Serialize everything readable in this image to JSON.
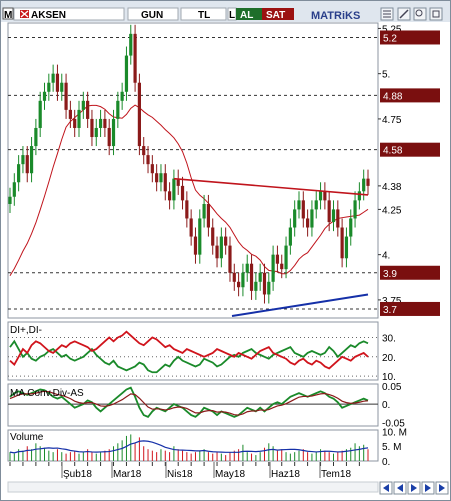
{
  "toolbar": {
    "app_icon_letter": "M",
    "symbol": "AKSEN",
    "period": "GUN",
    "currency": "TL",
    "small_label": "L",
    "buy_label": "AL",
    "sell_label": "SAT",
    "brand": "MATRiKS",
    "icons": [
      "grid-icon",
      "settings-icon",
      "zoom-icon",
      "restore-icon"
    ]
  },
  "colors": {
    "candle_up": "#1a8a2a",
    "candle_down": "#8b1a1a",
    "price_label_bg": "#7a0f0f",
    "moving_average": "#c0141c",
    "support_line": "#1530a8",
    "di_plus": "#1a8a2a",
    "di_minus": "#d0141c",
    "macd": "#1a8a2a",
    "signal": "#8b1a1a",
    "volume_down": "#d0141c",
    "volume_up": "#1a8a2a",
    "volume_ma": "#1530a8",
    "buy_bg": "#1e6e2a",
    "sell_bg": "#9b1111"
  },
  "price_panel": {
    "axis_labels": [
      "5.25",
      "5.",
      "4.75",
      "4.38",
      "4.25",
      "4.",
      "3.75"
    ],
    "level_labels": [
      "5.2",
      "4.88",
      "4.58",
      "3.9",
      "3.7"
    ],
    "ylim": [
      3.65,
      5.28
    ]
  },
  "dmi_panel": {
    "title": "DI+,DI-",
    "axis_labels": [
      "30.",
      "20.",
      "10."
    ]
  },
  "macd_panel": {
    "title": "MA Conv.Div-AS",
    "axis_labels": [
      "0.05",
      "0.",
      "-0.05"
    ]
  },
  "volume_panel": {
    "title": "Volume",
    "axis_labels": [
      "10. M",
      "5. M",
      "0."
    ]
  },
  "x_axis": {
    "labels": [
      "Şub18",
      "Mar18",
      "Nis18",
      "May18",
      "Haz18",
      "Tem18"
    ]
  },
  "chart_data": [
    {
      "type": "candlestick",
      "name": "price",
      "ylim": [
        3.65,
        5.28
      ],
      "horizontal_levels": [
        5.2,
        4.88,
        4.58,
        3.9,
        3.7
      ],
      "approx_close": [
        4.32,
        4.4,
        4.5,
        4.55,
        4.45,
        4.6,
        4.7,
        4.85,
        4.9,
        4.95,
        5.0,
        4.9,
        4.95,
        4.8,
        4.75,
        4.7,
        4.8,
        4.85,
        4.75,
        4.65,
        4.7,
        4.75,
        4.7,
        4.6,
        4.75,
        4.85,
        4.9,
        5.1,
        5.22,
        4.95,
        4.6,
        4.55,
        4.5,
        4.45,
        4.4,
        4.45,
        4.35,
        4.3,
        4.42,
        4.38,
        4.3,
        4.2,
        4.1,
        4.0,
        4.2,
        4.28,
        4.15,
        4.05,
        3.98,
        4.1,
        4.05,
        3.9,
        3.85,
        3.82,
        3.9,
        3.95,
        3.8,
        3.85,
        3.9,
        3.78,
        3.85,
        4.0,
        3.95,
        3.92,
        4.05,
        4.15,
        4.25,
        4.3,
        4.2,
        4.15,
        4.25,
        4.3,
        4.35,
        4.3,
        4.18,
        4.25,
        4.15,
        3.98,
        4.1,
        4.2,
        4.3,
        4.35,
        4.42,
        4.38
      ]
    },
    {
      "type": "line",
      "name": "DI+,DI-",
      "ylim": [
        8,
        38
      ],
      "series": [
        {
          "name": "DI+",
          "values": [
            25,
            28,
            24,
            20,
            22,
            19,
            18,
            20,
            21,
            23,
            24,
            22,
            20,
            21,
            19,
            18,
            19,
            20,
            22,
            24,
            21,
            19,
            17,
            16,
            18,
            15,
            14,
            13,
            14,
            15,
            17,
            16,
            13,
            12,
            12,
            14,
            16,
            15,
            18,
            20,
            18,
            17,
            16,
            15,
            16,
            19,
            18,
            17,
            15,
            16,
            18,
            20,
            21,
            20,
            22,
            23,
            24,
            22,
            21,
            20,
            19,
            21,
            22,
            23,
            24,
            25,
            22,
            21,
            20,
            22,
            23,
            22,
            21,
            22,
            25,
            23,
            20,
            22,
            24,
            26,
            25,
            27,
            28,
            27
          ]
        },
        {
          "name": "DI-",
          "values": [
            18,
            16,
            20,
            24,
            22,
            26,
            28,
            27,
            25,
            23,
            22,
            24,
            26,
            25,
            27,
            28,
            27,
            26,
            25,
            23,
            24,
            26,
            28,
            30,
            28,
            30,
            31,
            33,
            31,
            29,
            27,
            26,
            28,
            30,
            29,
            27,
            25,
            26,
            24,
            23,
            22,
            24,
            23,
            22,
            21,
            20,
            21,
            22,
            24,
            23,
            22,
            21,
            20,
            22,
            21,
            20,
            19,
            21,
            23,
            24,
            25,
            22,
            21,
            20,
            19,
            17,
            16,
            18,
            19,
            17,
            16,
            18,
            17,
            15,
            14,
            16,
            18,
            20,
            19,
            18,
            20,
            21,
            22,
            20
          ]
        }
      ]
    },
    {
      "type": "line",
      "name": "MA Conv.Div-AS",
      "ylim": [
        -0.06,
        0.055
      ],
      "series": [
        {
          "name": "macd",
          "values": [
            0.02,
            0.03,
            0.035,
            0.03,
            0.025,
            0.03,
            0.035,
            0.04,
            0.038,
            0.03,
            0.02,
            0.015,
            0.02,
            0.01,
            0.0,
            -0.01,
            -0.005,
            0.0,
            0.01,
            0.005,
            -0.01,
            -0.02,
            -0.01,
            0.0,
            0.01,
            0.02,
            0.03,
            0.04,
            0.045,
            0.02,
            -0.01,
            -0.03,
            -0.035,
            -0.02,
            -0.01,
            -0.015,
            -0.02,
            -0.01,
            0.0,
            -0.005,
            -0.01,
            -0.02,
            -0.03,
            -0.035,
            -0.025,
            -0.01,
            -0.015,
            -0.02,
            -0.03,
            -0.02,
            -0.025,
            -0.03,
            -0.035,
            -0.03,
            -0.02,
            -0.01,
            -0.015,
            -0.02,
            -0.01,
            -0.02,
            -0.01,
            0.0,
            0.005,
            0.0,
            0.01,
            0.02,
            0.025,
            0.03,
            0.025,
            0.02,
            0.025,
            0.03,
            0.035,
            0.03,
            0.02,
            0.015,
            0.005,
            -0.01,
            -0.005,
            0.0,
            0.005,
            0.01,
            0.015,
            0.01
          ]
        },
        {
          "name": "signal",
          "values": [
            0.015,
            0.02,
            0.025,
            0.028,
            0.028,
            0.028,
            0.03,
            0.033,
            0.035,
            0.034,
            0.03,
            0.026,
            0.024,
            0.02,
            0.015,
            0.008,
            0.004,
            0.002,
            0.004,
            0.004,
            0.0,
            -0.005,
            -0.006,
            -0.004,
            0.0,
            0.006,
            0.012,
            0.02,
            0.028,
            0.026,
            0.016,
            0.004,
            -0.008,
            -0.014,
            -0.013,
            -0.014,
            -0.016,
            -0.014,
            -0.01,
            -0.008,
            -0.009,
            -0.012,
            -0.018,
            -0.024,
            -0.024,
            -0.02,
            -0.018,
            -0.018,
            -0.022,
            -0.021,
            -0.022,
            -0.025,
            -0.029,
            -0.03,
            -0.027,
            -0.021,
            -0.019,
            -0.019,
            -0.016,
            -0.017,
            -0.015,
            -0.01,
            -0.005,
            -0.003,
            0.001,
            0.007,
            0.013,
            0.019,
            0.021,
            0.021,
            0.022,
            0.025,
            0.028,
            0.029,
            0.026,
            0.022,
            0.016,
            0.008,
            0.004,
            0.002,
            0.003,
            0.005,
            0.008,
            0.009
          ]
        }
      ]
    },
    {
      "type": "bar",
      "name": "Volume",
      "ylim": [
        0,
        10.5
      ],
      "unit": "M",
      "values": [
        3,
        2.5,
        4,
        3.5,
        5,
        4,
        6,
        5,
        4.5,
        3.5,
        3,
        4,
        3,
        2.5,
        3,
        3.5,
        2.5,
        3,
        4,
        3,
        2.5,
        3,
        3.5,
        4,
        5,
        6,
        7,
        8.5,
        9,
        6,
        8,
        5,
        4,
        3.5,
        3,
        4,
        3.5,
        3,
        5,
        4,
        3.5,
        3,
        2.5,
        3,
        3.5,
        4,
        3,
        2.5,
        3,
        2.5,
        2,
        3,
        3.5,
        4,
        5.5,
        3,
        2.5,
        2,
        3,
        4.5,
        6,
        5,
        3.5,
        4,
        3,
        2.5,
        3,
        3.5,
        4,
        3,
        2.5,
        3,
        4,
        3.5,
        3,
        2.5,
        3,
        3.5,
        4,
        4.5,
        6,
        5,
        5.5,
        4
      ]
    }
  ]
}
